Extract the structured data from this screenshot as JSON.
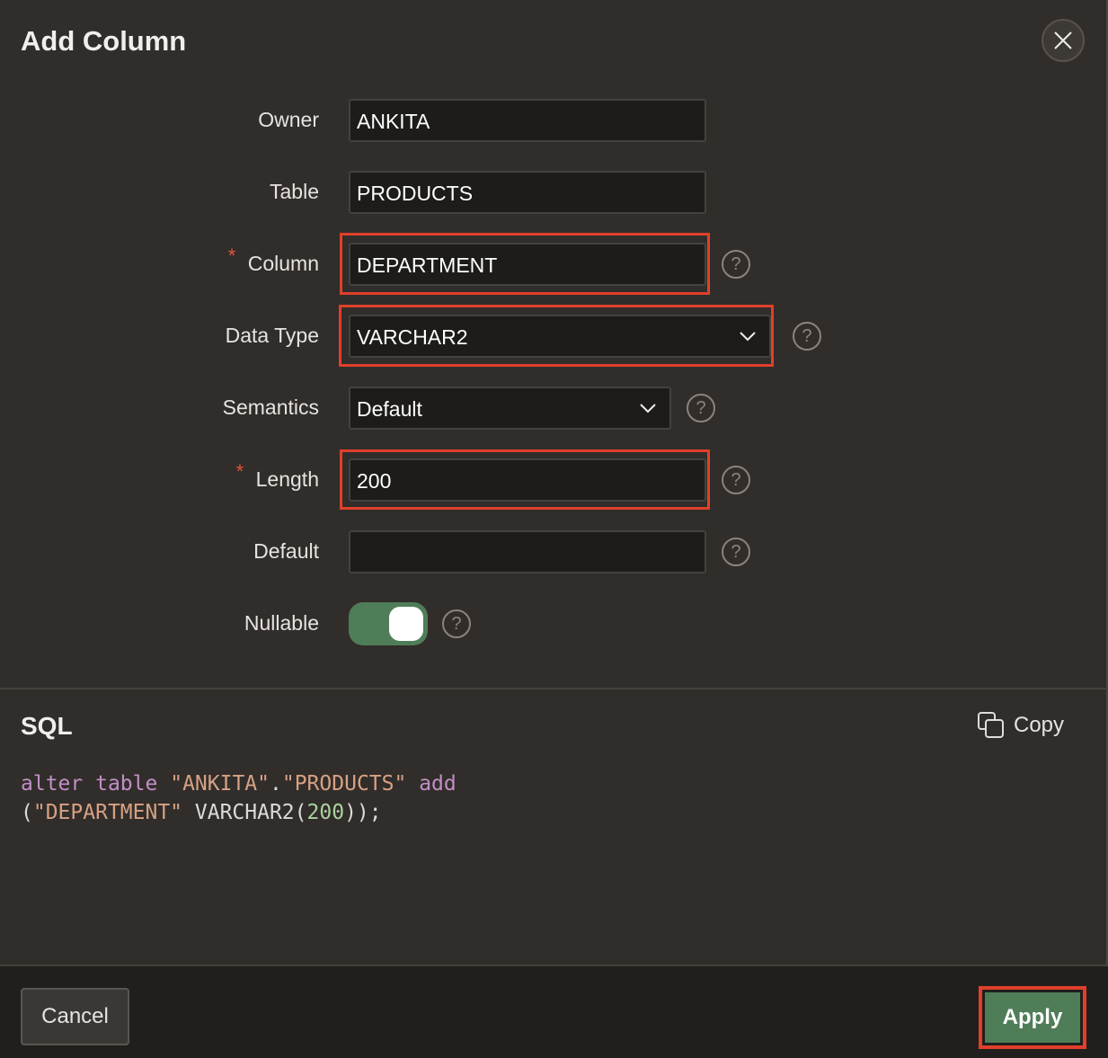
{
  "dialog": {
    "title": "Add Column"
  },
  "form": {
    "owner": {
      "label": "Owner",
      "value": "ANKITA"
    },
    "table": {
      "label": "Table",
      "value": "PRODUCTS"
    },
    "column": {
      "label": "Column",
      "value": "DEPARTMENT",
      "required": "*"
    },
    "data_type": {
      "label": "Data Type",
      "value": "VARCHAR2"
    },
    "semantics": {
      "label": "Semantics",
      "value": "Default"
    },
    "length": {
      "label": "Length",
      "value": "200",
      "required": "*"
    },
    "default": {
      "label": "Default",
      "value": ""
    },
    "nullable": {
      "label": "Nullable",
      "on": true
    }
  },
  "help_glyph": "?",
  "sql": {
    "heading": "SQL",
    "copy_label": "Copy",
    "tokens": {
      "alter": "alter",
      "table": "table",
      "owner": "\"ANKITA\"",
      "dot": ".",
      "tbl": "\"PRODUCTS\"",
      "add": "add",
      "open": "(",
      "col": "\"DEPARTMENT\"",
      "type": " VARCHAR2(",
      "len": "200",
      "close": "));"
    }
  },
  "footer": {
    "cancel_label": "Cancel",
    "apply_label": "Apply"
  },
  "colors": {
    "highlight": "#e0402b",
    "accent": "#4f7d58"
  }
}
